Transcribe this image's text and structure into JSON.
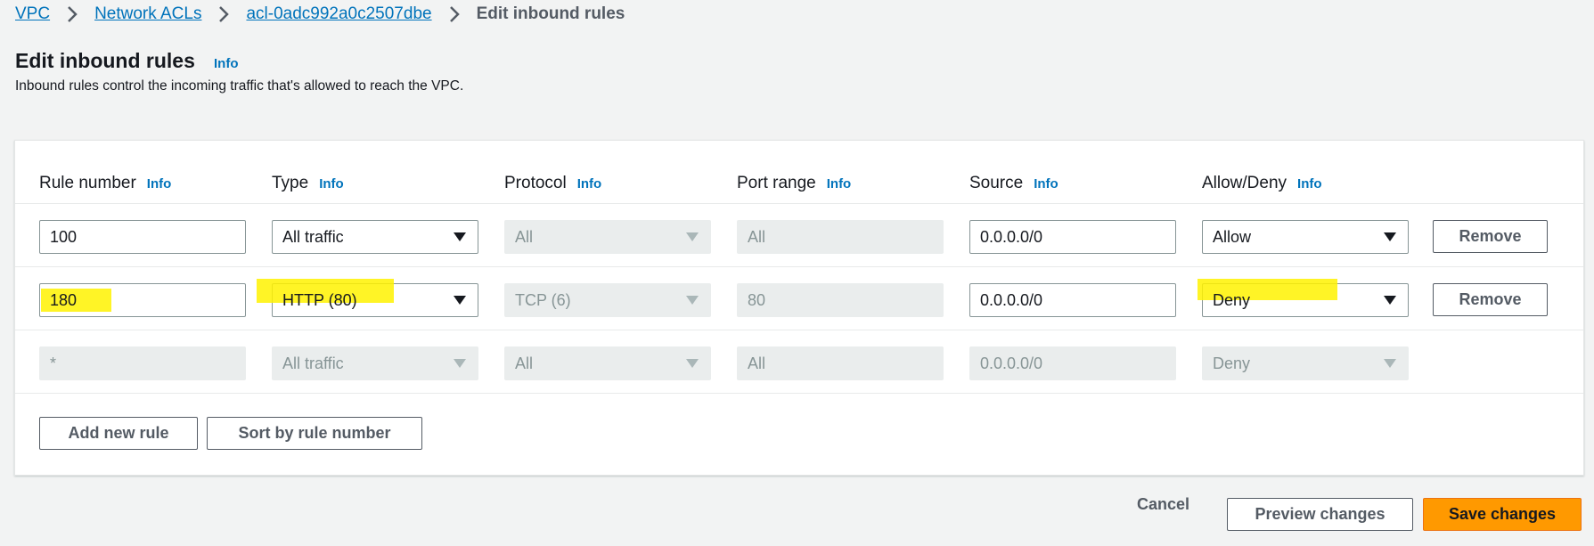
{
  "breadcrumb": {
    "vpc": "VPC",
    "network_acls": "Network ACLs",
    "acl_id": "acl-0adc992a0c2507dbe",
    "current": "Edit inbound rules"
  },
  "page": {
    "title": "Edit inbound rules",
    "info": "Info",
    "description": "Inbound rules control the incoming traffic that's allowed to reach the VPC."
  },
  "table": {
    "headers": {
      "rule_number": "Rule number",
      "type": "Type",
      "protocol": "Protocol",
      "port_range": "Port range",
      "source": "Source",
      "allow_deny": "Allow/Deny"
    },
    "info_label": "Info",
    "rows": [
      {
        "rule_number": "100",
        "type": "All traffic",
        "protocol": "All",
        "port_range": "All",
        "source": "0.0.0.0/0",
        "allow_deny": "Allow",
        "remove": "Remove"
      },
      {
        "rule_number": "180",
        "type": "HTTP (80)",
        "protocol": "TCP (6)",
        "port_range": "80",
        "source": "0.0.0.0/0",
        "allow_deny": "Deny",
        "remove": "Remove"
      },
      {
        "rule_number": "*",
        "type": "All traffic",
        "protocol": "All",
        "port_range": "All",
        "source": "0.0.0.0/0",
        "allow_deny": "Deny"
      }
    ],
    "add_rule": "Add new rule",
    "sort_rules": "Sort by rule number"
  },
  "footer": {
    "cancel": "Cancel",
    "preview": "Preview changes",
    "save": "Save changes"
  },
  "colors": {
    "link": "#0073bb",
    "primary": "#ff9900",
    "highlight": "#fff200"
  }
}
